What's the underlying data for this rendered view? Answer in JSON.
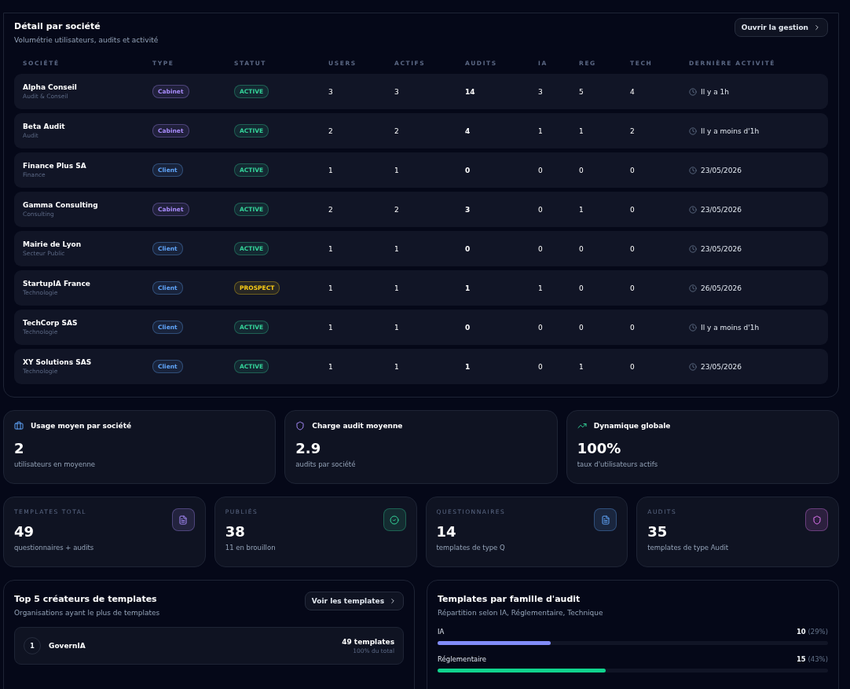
{
  "companies": {
    "title": "Détail par société",
    "subtitle": "Volumétrie utilisateurs, audits et activité",
    "action": "Ouvrir la gestion",
    "columns": [
      "SOCIÉTÉ",
      "TYPE",
      "STATUT",
      "USERS",
      "ACTIFS",
      "AUDITS",
      "IA",
      "REG",
      "TECH",
      "DERNIÈRE ACTIVITÉ"
    ],
    "rows": [
      {
        "name": "Alpha Conseil",
        "sector": "Audit & Conseil",
        "type": {
          "label": "Cabinet",
          "color": "#a78bfa"
        },
        "status": {
          "label": "ACTIVE",
          "color": "#34d399"
        },
        "users": "3",
        "active": "3",
        "audits": "14",
        "ia": "3",
        "reg": "5",
        "tech": "4",
        "last": "Il y a 1h"
      },
      {
        "name": "Beta Audit",
        "sector": "Audit",
        "type": {
          "label": "Cabinet",
          "color": "#a78bfa"
        },
        "status": {
          "label": "ACTIVE",
          "color": "#34d399"
        },
        "users": "2",
        "active": "2",
        "audits": "4",
        "ia": "1",
        "reg": "1",
        "tech": "2",
        "last": "Il y a moins d'1h"
      },
      {
        "name": "Finance Plus SA",
        "sector": "Finance",
        "type": {
          "label": "Client",
          "color": "#60a5fa"
        },
        "status": {
          "label": "ACTIVE",
          "color": "#34d399"
        },
        "users": "1",
        "active": "1",
        "audits": "0",
        "ia": "0",
        "reg": "0",
        "tech": "0",
        "last": "23/05/2026"
      },
      {
        "name": "Gamma Consulting",
        "sector": "Consulting",
        "type": {
          "label": "Cabinet",
          "color": "#a78bfa"
        },
        "status": {
          "label": "ACTIVE",
          "color": "#34d399"
        },
        "users": "2",
        "active": "2",
        "audits": "3",
        "ia": "0",
        "reg": "1",
        "tech": "0",
        "last": "23/05/2026"
      },
      {
        "name": "Mairie de Lyon",
        "sector": "Secteur Public",
        "type": {
          "label": "Client",
          "color": "#60a5fa"
        },
        "status": {
          "label": "ACTIVE",
          "color": "#34d399"
        },
        "users": "1",
        "active": "1",
        "audits": "0",
        "ia": "0",
        "reg": "0",
        "tech": "0",
        "last": "23/05/2026"
      },
      {
        "name": "StartupIA France",
        "sector": "Technologie",
        "type": {
          "label": "Client",
          "color": "#60a5fa"
        },
        "status": {
          "label": "PROSPECT",
          "color": "#facc15"
        },
        "users": "1",
        "active": "1",
        "audits": "1",
        "ia": "1",
        "reg": "0",
        "tech": "0",
        "last": "26/05/2026"
      },
      {
        "name": "TechCorp SAS",
        "sector": "Technologie",
        "type": {
          "label": "Client",
          "color": "#60a5fa"
        },
        "status": {
          "label": "ACTIVE",
          "color": "#34d399"
        },
        "users": "1",
        "active": "1",
        "audits": "0",
        "ia": "0",
        "reg": "0",
        "tech": "0",
        "last": "Il y a moins d'1h"
      },
      {
        "name": "XY Solutions SAS",
        "sector": "Technologie",
        "type": {
          "label": "Client",
          "color": "#60a5fa"
        },
        "status": {
          "label": "ACTIVE",
          "color": "#34d399"
        },
        "users": "1",
        "active": "1",
        "audits": "1",
        "ia": "0",
        "reg": "1",
        "tech": "0",
        "last": "23/05/2026"
      }
    ]
  },
  "averages": [
    {
      "title": "Usage moyen par société",
      "value": "2",
      "caption": "utilisateurs en moyenne"
    },
    {
      "title": "Charge audit moyenne",
      "value": "2.9",
      "caption": "audits par société"
    },
    {
      "title": "Dynamique globale",
      "value": "100%",
      "caption": "taux d'utilisateurs actifs"
    }
  ],
  "templates": [
    {
      "label": "TEMPLATES TOTAL",
      "value": "49",
      "caption": "questionnaires + audits"
    },
    {
      "label": "PUBLIÉS",
      "value": "38",
      "caption": "11 en brouillon"
    },
    {
      "label": "QUESTIONNAIRES",
      "value": "14",
      "caption": "templates de type Q"
    },
    {
      "label": "AUDITS",
      "value": "35",
      "caption": "templates de type Audit"
    }
  ],
  "creators": {
    "title": "Top 5 créateurs de templates",
    "subtitle": "Organisations ayant le plus de templates",
    "action": "Voir les templates",
    "items": [
      {
        "rank": "1",
        "name": "GovernIA",
        "count": "49 templates",
        "share": "100% du total"
      }
    ]
  },
  "families": {
    "title": "Templates par famille d'audit",
    "subtitle": "Répartition selon IA, Réglementaire, Technique",
    "items": [
      {
        "name": "IA",
        "count": "10",
        "percent": "(29%)",
        "level": 0.29,
        "color": "#818cf8"
      },
      {
        "name": "Réglementaire",
        "count": "15",
        "percent": "(43%)",
        "level": 0.43,
        "color": "#10d48e"
      }
    ]
  }
}
